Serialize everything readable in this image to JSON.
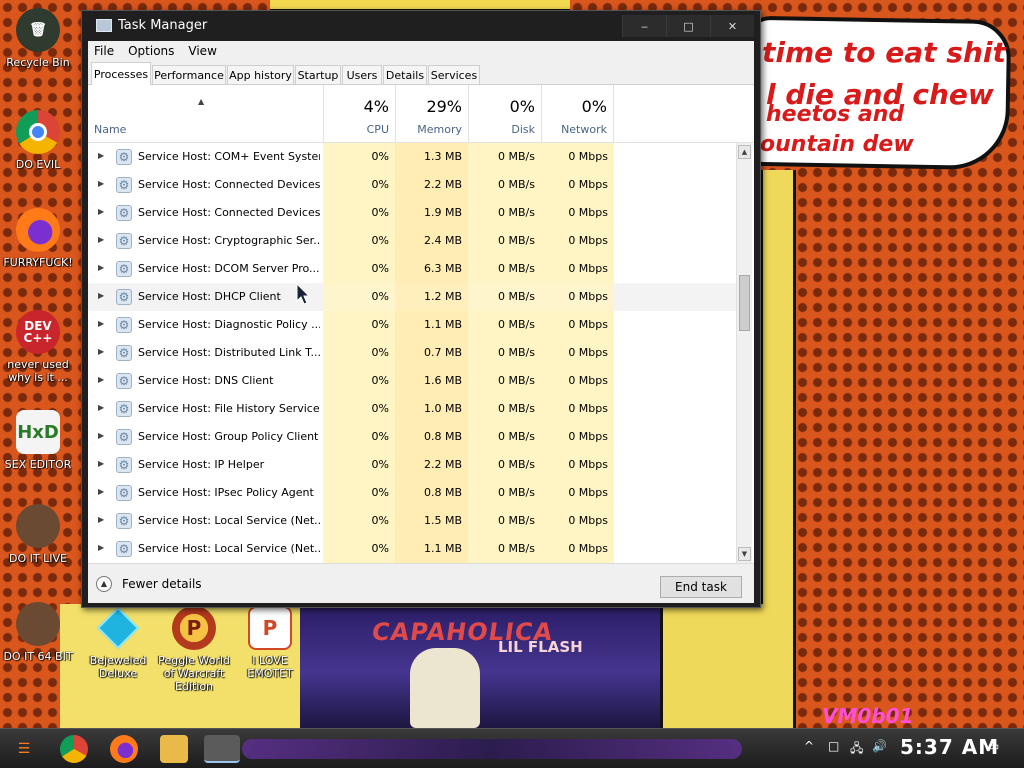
{
  "desktop": {
    "icons": [
      {
        "label": "Recycle Bin"
      },
      {
        "label": "DO EVIL"
      },
      {
        "label": "FURRYFUCK!"
      },
      {
        "label": "never used why is it ..."
      },
      {
        "label": "SEX EDITOR"
      },
      {
        "label": "DO IT LIVE"
      },
      {
        "label": "DO IT 64 BIT"
      },
      {
        "label": "Bejeweled Deluxe"
      },
      {
        "label": "Peggle World of Warcraft Edition"
      },
      {
        "label": "I LOVE EMOTET"
      }
    ],
    "wallpaper_text": {
      "bubble_line1": "time to eat shit",
      "bubble_line2": "l die and chew",
      "bubble_line3": "heetos and",
      "bubble_line4": "ountain dew",
      "poster_title": "CAPAHOLICA",
      "poster_sub": "LIL FLASH",
      "watermark": "VM0b01"
    }
  },
  "window": {
    "title": "Task Manager",
    "minimize": "‒",
    "maximize": "□",
    "close": "✕"
  },
  "menu": [
    "File",
    "Options",
    "View"
  ],
  "tabs": [
    "Processes",
    "Performance",
    "App history",
    "Startup",
    "Users",
    "Details",
    "Services"
  ],
  "active_tab": "Processes",
  "columns": {
    "name": "Name",
    "cpu": {
      "pct": "4%",
      "label": "CPU"
    },
    "memory": {
      "pct": "29%",
      "label": "Memory"
    },
    "disk": {
      "pct": "0%",
      "label": "Disk"
    },
    "network": {
      "pct": "0%",
      "label": "Network"
    }
  },
  "processes": [
    {
      "name": "Service Host: COM+ Event System",
      "cpu": "0%",
      "memory": "1.3 MB",
      "disk": "0 MB/s",
      "network": "0 Mbps"
    },
    {
      "name": "Service Host: Connected Devices...",
      "cpu": "0%",
      "memory": "2.2 MB",
      "disk": "0 MB/s",
      "network": "0 Mbps"
    },
    {
      "name": "Service Host: Connected Devices...",
      "cpu": "0%",
      "memory": "1.9 MB",
      "disk": "0 MB/s",
      "network": "0 Mbps"
    },
    {
      "name": "Service Host: Cryptographic Ser...",
      "cpu": "0%",
      "memory": "2.4 MB",
      "disk": "0 MB/s",
      "network": "0 Mbps"
    },
    {
      "name": "Service Host: DCOM Server Pro...",
      "cpu": "0%",
      "memory": "6.3 MB",
      "disk": "0 MB/s",
      "network": "0 Mbps"
    },
    {
      "name": "Service Host: DHCP Client",
      "cpu": "0%",
      "memory": "1.2 MB",
      "disk": "0 MB/s",
      "network": "0 Mbps"
    },
    {
      "name": "Service Host: Diagnostic Policy ...",
      "cpu": "0%",
      "memory": "1.1 MB",
      "disk": "0 MB/s",
      "network": "0 Mbps"
    },
    {
      "name": "Service Host: Distributed Link T...",
      "cpu": "0%",
      "memory": "0.7 MB",
      "disk": "0 MB/s",
      "network": "0 Mbps"
    },
    {
      "name": "Service Host: DNS Client",
      "cpu": "0%",
      "memory": "1.6 MB",
      "disk": "0 MB/s",
      "network": "0 Mbps"
    },
    {
      "name": "Service Host: File History Service",
      "cpu": "0%",
      "memory": "1.0 MB",
      "disk": "0 MB/s",
      "network": "0 Mbps"
    },
    {
      "name": "Service Host: Group Policy Client",
      "cpu": "0%",
      "memory": "0.8 MB",
      "disk": "0 MB/s",
      "network": "0 Mbps"
    },
    {
      "name": "Service Host: IP Helper",
      "cpu": "0%",
      "memory": "2.2 MB",
      "disk": "0 MB/s",
      "network": "0 Mbps"
    },
    {
      "name": "Service Host: IPsec Policy Agent",
      "cpu": "0%",
      "memory": "0.8 MB",
      "disk": "0 MB/s",
      "network": "0 Mbps"
    },
    {
      "name": "Service Host: Local Service (Net...",
      "cpu": "0%",
      "memory": "1.5 MB",
      "disk": "0 MB/s",
      "network": "0 Mbps"
    },
    {
      "name": "Service Host: Local Service (Net...",
      "cpu": "0%",
      "memory": "1.1 MB",
      "disk": "0 MB/s",
      "network": "0 Mbps"
    }
  ],
  "selected_row": 5,
  "footer": {
    "fewer_details": "Fewer details",
    "end_task": "End task"
  },
  "taskbar": {
    "clock": "5:37 AM"
  },
  "colors": {
    "cpu_heat": "#fff4c4",
    "mem_heat": "#ffedb3",
    "accent": "#4a6486"
  }
}
